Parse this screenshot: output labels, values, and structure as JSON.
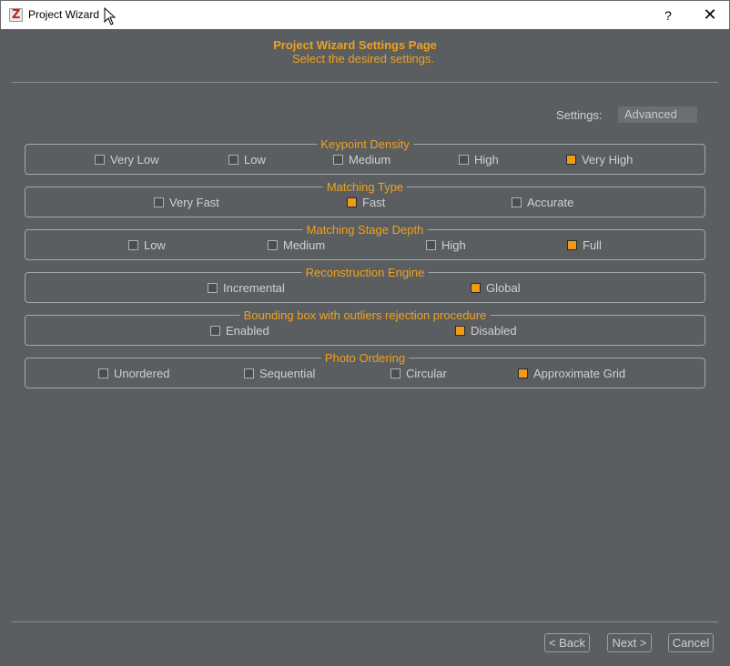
{
  "window": {
    "title": "Project Wizard",
    "help_label": "?",
    "close_label": "✕",
    "app_icon_letter": "Z"
  },
  "header": {
    "title": "Project Wizard Settings Page",
    "subtitle": "Select the desired settings."
  },
  "settings": {
    "label": "Settings:",
    "value": "Advanced"
  },
  "groups": [
    {
      "title": "Keypoint Density",
      "options": [
        {
          "label": "Very Low",
          "checked": false
        },
        {
          "label": "Low",
          "checked": false
        },
        {
          "label": "Medium",
          "checked": false
        },
        {
          "label": "High",
          "checked": false
        },
        {
          "label": "Very High",
          "checked": true
        }
      ]
    },
    {
      "title": "Matching Type",
      "options": [
        {
          "label": "Very Fast",
          "checked": false
        },
        {
          "label": "Fast",
          "checked": true
        },
        {
          "label": "Accurate",
          "checked": false
        }
      ]
    },
    {
      "title": "Matching Stage Depth",
      "options": [
        {
          "label": "Low",
          "checked": false
        },
        {
          "label": "Medium",
          "checked": false
        },
        {
          "label": "High",
          "checked": false
        },
        {
          "label": "Full",
          "checked": true
        }
      ]
    },
    {
      "title": "Reconstruction Engine",
      "options": [
        {
          "label": "Incremental",
          "checked": false
        },
        {
          "label": "Global",
          "checked": true
        }
      ]
    },
    {
      "title": "Bounding box with outliers rejection procedure",
      "options": [
        {
          "label": "Enabled",
          "checked": false
        },
        {
          "label": "Disabled",
          "checked": true
        }
      ]
    },
    {
      "title": "Photo Ordering",
      "options": [
        {
          "label": "Unordered",
          "checked": false
        },
        {
          "label": "Sequential",
          "checked": false
        },
        {
          "label": "Circular",
          "checked": false
        },
        {
          "label": "Approximate Grid",
          "checked": true
        }
      ]
    }
  ],
  "buttons": {
    "back": "< Back",
    "next": "Next >",
    "cancel": "Cancel"
  },
  "colors": {
    "accent": "#f0a11c",
    "background": "#5a5e61",
    "checked": "#f29a17"
  }
}
